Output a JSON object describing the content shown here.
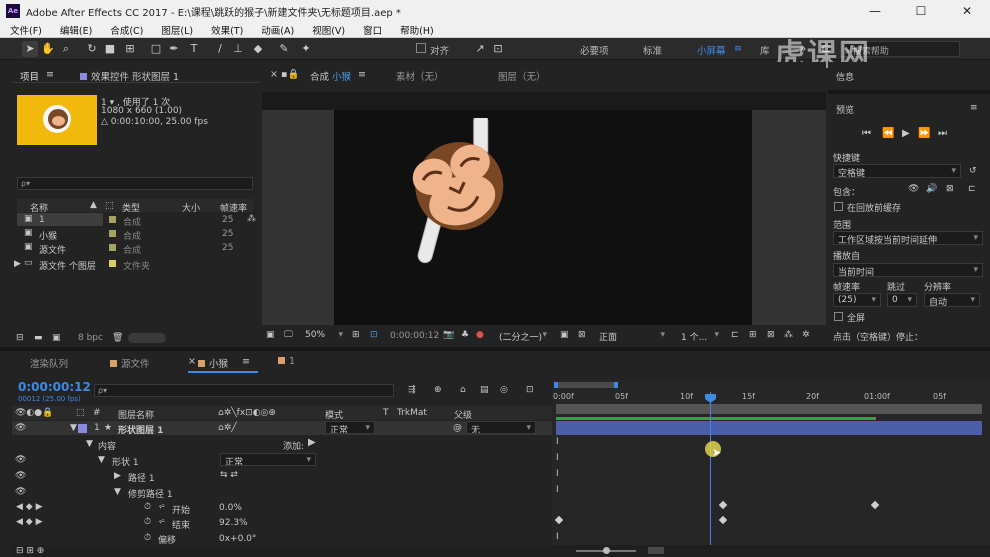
{
  "window": {
    "app_badge": "Ae",
    "title": "Adobe After Effects CC 2017 - E:\\课程\\跳跃的猴子\\新建文件夹\\无标题项目.aep *",
    "minimize": "—",
    "maximize": "☐",
    "close": "✕"
  },
  "menu": [
    "文件(F)",
    "编辑(E)",
    "合成(C)",
    "图层(L)",
    "效果(T)",
    "动画(A)",
    "视图(V)",
    "窗口",
    "帮助(H)"
  ],
  "toolbar": {
    "snap_label": "对齐",
    "workspaces": [
      "必要项",
      "标准",
      "小屏幕"
    ],
    "more_ws": "库",
    "search_help": "搜索帮助"
  },
  "watermark": "虎课网",
  "project_panel": {
    "tab": "项目",
    "tab_menu": "≡",
    "effects_tab": "效果控件 形状图层 1",
    "item_name": "1",
    "item_usage": "▾ , 使用了 1 次",
    "item_size": "1080 x 660 (1.00)",
    "item_duration": "△ 0:00:10:00, 25.00 fps",
    "search_placeholder": "ρ▾",
    "columns": [
      "名称",
      "类型",
      "大小",
      "帧速率"
    ],
    "rows": [
      {
        "name": "1",
        "type": "合成",
        "fps": "25"
      },
      {
        "name": "小猴",
        "type": "合成",
        "fps": "25"
      },
      {
        "name": "源文件",
        "type": "合成",
        "fps": "25"
      },
      {
        "name": "源文件 个图层",
        "type": "文件夹",
        "fps": ""
      }
    ],
    "bpc": "8 bpc"
  },
  "comp_panel": {
    "tabs": [
      {
        "label": "合成",
        "sub": "小猴"
      },
      {
        "label": "素材（无）"
      },
      {
        "label": "图层（无）"
      }
    ],
    "zoom": "50%",
    "timecode": "0:00:00:12",
    "resolution": "(二分之一)",
    "view": "正面",
    "views_count": "1 个..."
  },
  "right_panel": {
    "info": "信息",
    "preview": "预览",
    "shortcut_label": "快捷键",
    "shortcut_value": "空格键",
    "include_label": "包含：",
    "cache_label": "在回放前缓存",
    "range_label": "范围",
    "range_value": "工作区域按当前时间延伸",
    "play_from_label": "播放自",
    "play_from_value": "当前时间",
    "framerate_label": "帧速率",
    "skip_label": "跳过",
    "res_label": "分辨率",
    "framerate_value": "(25)",
    "skip_value": "0",
    "res_value": "自动",
    "fullscreen_label": "全屏",
    "stop_hint": "点击（空格键）停止："
  },
  "timeline": {
    "tabs": [
      "渲染队列",
      "源文件",
      "小猴",
      "1"
    ],
    "current_time": "0:00:00:12",
    "frame_info": "00012 (25.00 fps)",
    "search_placeholder": "ρ▾",
    "col_layer": "图层名称",
    "col_mode": "模式",
    "col_t": "T",
    "col_trkmat": "TrkMat",
    "col_parent": "父级",
    "col_num": "#",
    "ruler_labels": [
      "0:00f",
      "05f",
      "10f",
      "15f",
      "20f",
      "01:00f",
      "05f"
    ],
    "layer": {
      "num": "1",
      "name": "形状图层 1",
      "mode": "正常",
      "parent": "无"
    },
    "props": {
      "contents": "内容",
      "add": "添加:",
      "shape": "形状 1",
      "shape_mode": "正常",
      "path": "路径 1",
      "trim": "修剪路径 1",
      "start_label": "开始",
      "start_value": "0.0%",
      "end_label": "结束",
      "end_value": "92.3%",
      "offset_label": "偏移",
      "offset_value": "0x+0.0°"
    }
  },
  "colors": {
    "accent": "#3d8be6",
    "monkey_brown": "#7a4724",
    "monkey_face": "#f0b48c",
    "project_thumb": "#f2b90d"
  }
}
